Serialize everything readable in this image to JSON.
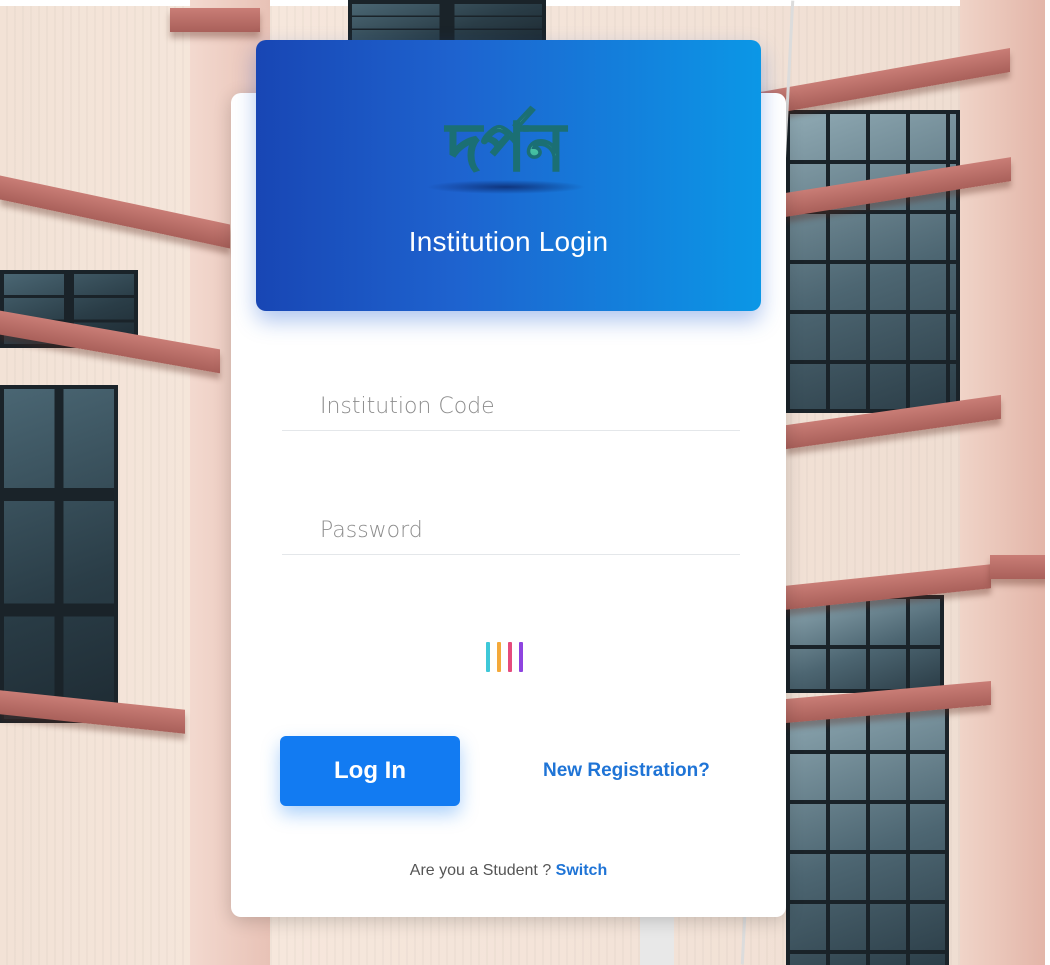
{
  "header": {
    "logo_text": "দর্পন",
    "title": "Institution Login"
  },
  "form": {
    "institution_code": {
      "placeholder": "Institution Code",
      "value": ""
    },
    "password": {
      "placeholder": "Password",
      "value": ""
    }
  },
  "captcha": {
    "bar_colors": [
      "#3ec8d8",
      "#f4a93a",
      "#e54b7d",
      "#8e44e0"
    ]
  },
  "actions": {
    "login_label": "Log In",
    "new_registration_label": "New Registration?"
  },
  "footer": {
    "student_prompt": "Are you a Student ? ",
    "switch_label": "Switch"
  },
  "colors": {
    "header_start": "#1846b4",
    "header_end": "#0b97e6",
    "primary_button": "#127bf2",
    "link": "#1f74d6"
  }
}
